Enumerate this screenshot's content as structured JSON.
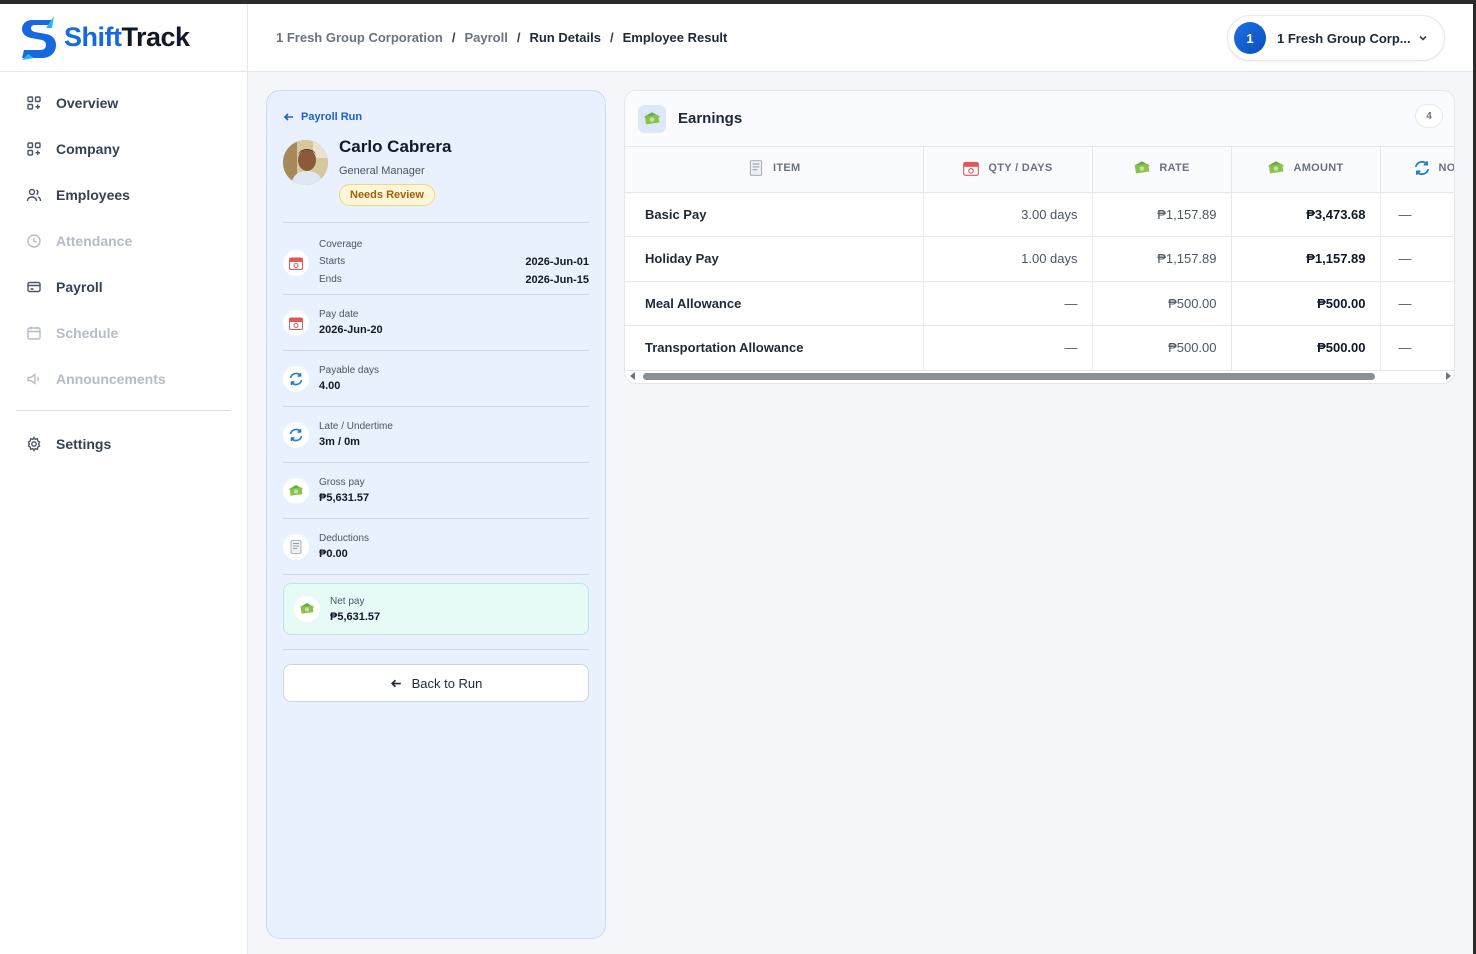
{
  "brand": {
    "part1": "Shift",
    "part2": "Track"
  },
  "sidebar": {
    "items": [
      {
        "label": "Overview",
        "icon": "grid-icon",
        "disabled": false
      },
      {
        "label": "Company",
        "icon": "grid-icon",
        "disabled": false
      },
      {
        "label": "Employees",
        "icon": "users-icon",
        "disabled": false
      },
      {
        "label": "Attendance",
        "icon": "clock-icon",
        "disabled": true
      },
      {
        "label": "Payroll",
        "icon": "wallet-icon",
        "disabled": false
      },
      {
        "label": "Schedule",
        "icon": "calendar-icon",
        "disabled": true
      },
      {
        "label": "Announcements",
        "icon": "megaphone-icon",
        "disabled": true
      }
    ],
    "settings_label": "Settings"
  },
  "header": {
    "breadcrumb": [
      "1 Fresh Group Corporation",
      "Payroll",
      "Run Details",
      "Employee Result"
    ],
    "company_initial": "1",
    "company_name": "1 Fresh Group Corp..."
  },
  "profile": {
    "back_label": "Payroll Run",
    "name": "Carlo Cabrera",
    "role": "General Manager",
    "status": "Needs Review",
    "coverage_label": "Coverage",
    "starts_label": "Starts",
    "starts_value": "2026-Jun-01",
    "ends_label": "Ends",
    "ends_value": "2026-Jun-15",
    "pay_date_label": "Pay date",
    "pay_date_value": "2026-Jun-20",
    "payable_days_label": "Payable days",
    "payable_days_value": "4.00",
    "late_label": "Late / Undertime",
    "late_value": "3m / 0m",
    "gross_label": "Gross pay",
    "gross_value": "₱5,631.57",
    "deductions_label": "Deductions",
    "deductions_value": "₱0.00",
    "net_label": "Net pay",
    "net_value": "₱5,631.57",
    "back_button": "Back to Run"
  },
  "earnings": {
    "title": "Earnings",
    "count": "4",
    "columns": [
      "ITEM",
      "QTY / DAYS",
      "RATE",
      "AMOUNT",
      "NO"
    ],
    "rows": [
      {
        "item": "Basic Pay",
        "qty": "3.00 days",
        "rate": "₱1,157.89",
        "amount": "₱3,473.68",
        "note": "—"
      },
      {
        "item": "Holiday Pay",
        "qty": "1.00 days",
        "rate": "₱1,157.89",
        "amount": "₱1,157.89",
        "note": "—"
      },
      {
        "item": "Meal Allowance",
        "qty": "—",
        "rate": "₱500.00",
        "amount": "₱500.00",
        "note": "—"
      },
      {
        "item": "Transportation Allowance",
        "qty": "—",
        "rate": "₱500.00",
        "amount": "₱500.00",
        "note": "—"
      }
    ]
  },
  "colors": {
    "brand_blue": "#1669e0",
    "panel_bg": "#e8f1fd",
    "badge_text": "#a16207",
    "net_bg": "#e6faf6"
  }
}
